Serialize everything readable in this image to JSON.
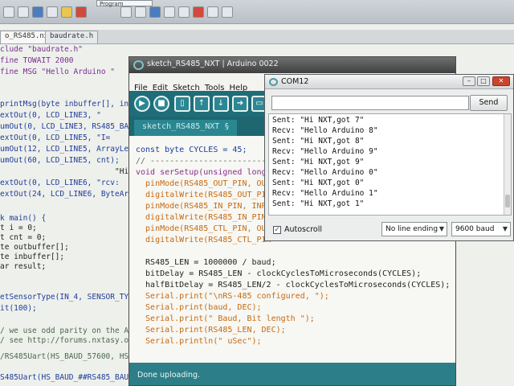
{
  "background_editor": {
    "top_menu": "Program",
    "tabs": [
      "o_RS485.nxc",
      "baudrate.h"
    ],
    "code_lines": [
      "clude \"baudrate.h\"",
      "fine TOWAIT 2000",
      "fine MSG \"Hello Arduino \"",
      "",
      "printMsg(byte inbuffer[], in",
      "extOut(0, LCD_LINE3, \"",
      "umOut(0, LCD_LINE3, RS485_BAUD",
      "extOut(0, LCD_LINE5, \"I=    cn",
      "umOut(12, LCD_LINE5, ArrayLen(",
      "umOut(60, LCD_LINE5, cnt);",
      "                         \"Hi N",
      "extOut(0, LCD_LINE6, \"rcv:",
      "extOut(24, LCD_LINE6, ByteArra",
      "",
      "",
      "k main() {",
      "t i = 0;",
      "t cnt = 0;",
      "te outbuffer[];",
      "te inbuffer[];",
      "ar result;",
      "",
      "etSensorType(IN_4, SENSOR_TYPE",
      "it(100);",
      "",
      "/ we use odd parity on the Ard",
      "/ see http://forums.nxtasy.or",
      "",
      "/RS485Uart(HS_BAUD_57600, HS_M",
      "",
      "S485Uart(HS_BAUD_##RS485_BAUD,"
    ]
  },
  "arduino": {
    "title": "sketch_RS485_NXT | Arduino 0022",
    "menus": [
      "File",
      "Edit",
      "Sketch",
      "Tools",
      "Help"
    ],
    "tab": "sketch_RS485_NXT §",
    "code_lines": [
      "const byte CYCLES = 45;",
      "// ------------------------",
      "void serSetup(unsigned long",
      "  pinMode(RS485_OUT_PIN, OUT",
      "  digitalWrite(RS485_OUT_PIN",
      "  pinMode(RS485_IN_PIN, INPU",
      "  digitalWrite(RS485_IN_PIN,",
      "  pinMode(RS485_CTL_PIN, OUT",
      "  digitalWrite(RS485_CTL_PIN",
      "",
      "  RS485_LEN = 1000000 / baud;",
      "  bitDelay = RS485_LEN - clockCyclesToMicroseconds(CYCLES);",
      "  halfBitDelay = RS485_LEN/2 - clockCyclesToMicroseconds(CYCLES);",
      "  Serial.print(\"\\nRS-485 configured, \");",
      "  Serial.print(baud, DEC);",
      "  Serial.print(\" Baud, Bit length \");",
      "  Serial.print(RS485_LEN, DEC);",
      "  Serial.println(\" uSec\");"
    ],
    "status": "Done uploading."
  },
  "serial_monitor": {
    "title": "COM12",
    "input_value": "",
    "send_label": "Send",
    "log": [
      "Sent: \"Hi NXT,got 7\"",
      "Recv: \"Hello Arduino 8\"",
      "Sent: \"Hi NXT,got 8\"",
      "Recv: \"Hello Arduino 9\"",
      "Sent: \"Hi NXT,got 9\"",
      "Recv: \"Hello Arduino 0\"",
      "Sent: \"Hi NXT,got 0\"",
      "Recv: \"Hello Arduino 1\"",
      "Sent: \"Hi NXT,got 1\""
    ],
    "autoscroll_label": "Autoscroll",
    "line_ending": "No line ending",
    "baud": "9600 baud"
  }
}
